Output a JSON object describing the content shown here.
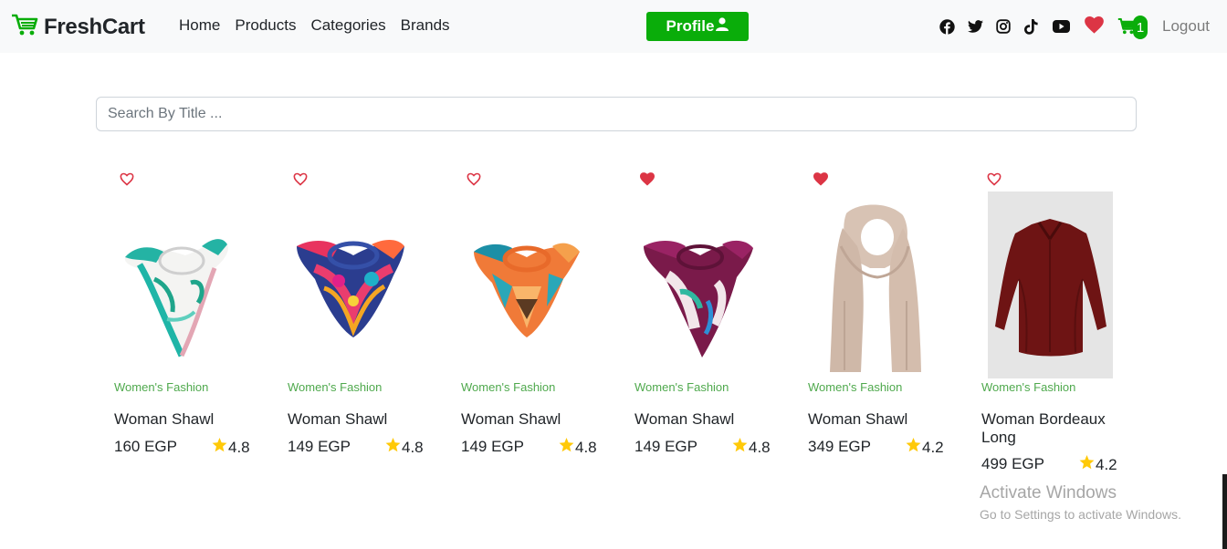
{
  "brand": {
    "name": "FreshCart",
    "icon": "cart-icon",
    "color": "#0aad0a"
  },
  "nav": {
    "links": [
      "Home",
      "Products",
      "Categories",
      "Brands"
    ]
  },
  "profile_button": {
    "label": "Profile",
    "icon": "user-icon"
  },
  "social_icons": [
    "facebook-icon",
    "twitter-icon",
    "instagram-icon",
    "tiktok-icon",
    "youtube-icon"
  ],
  "wishlist_icon": "heart-icon",
  "cart": {
    "count": "1",
    "icon": "cart-icon"
  },
  "logout_label": "Logout",
  "search": {
    "placeholder": "Search By Title ...",
    "value": ""
  },
  "products": [
    {
      "category": "Women's Fashion",
      "title": "Woman Shawl",
      "price": "160 EGP",
      "rating": "4.8",
      "wishlisted": false,
      "image": "floral-scarf-white-green"
    },
    {
      "category": "Women's Fashion",
      "title": "Woman Shawl",
      "price": "149 EGP",
      "rating": "4.8",
      "wishlisted": false,
      "image": "floral-scarf-navy-pink"
    },
    {
      "category": "Women's Fashion",
      "title": "Woman Shawl",
      "price": "149 EGP",
      "rating": "4.8",
      "wishlisted": false,
      "image": "geometric-scarf-orange-teal"
    },
    {
      "category": "Women's Fashion",
      "title": "Woman Shawl",
      "price": "149 EGP",
      "rating": "4.8",
      "wishlisted": true,
      "image": "floral-scarf-burgundy"
    },
    {
      "category": "Women's Fashion",
      "title": "Woman Shawl",
      "price": "349 EGP",
      "rating": "4.2",
      "wishlisted": true,
      "image": "long-scarf-beige"
    },
    {
      "category": "Women's Fashion",
      "title": "Woman Bordeaux Long",
      "price": "499 EGP",
      "rating": "4.2",
      "wishlisted": false,
      "image": "bordeaux-blouse"
    }
  ],
  "watermark": {
    "line1": "Activate Windows",
    "line2": "Go to Settings to activate Windows."
  },
  "colors": {
    "accent": "#0aad0a",
    "category": "#4fa94d",
    "heart": "#dc3545",
    "star": "#ffc908",
    "nav_bg": "#f8f9fa"
  }
}
